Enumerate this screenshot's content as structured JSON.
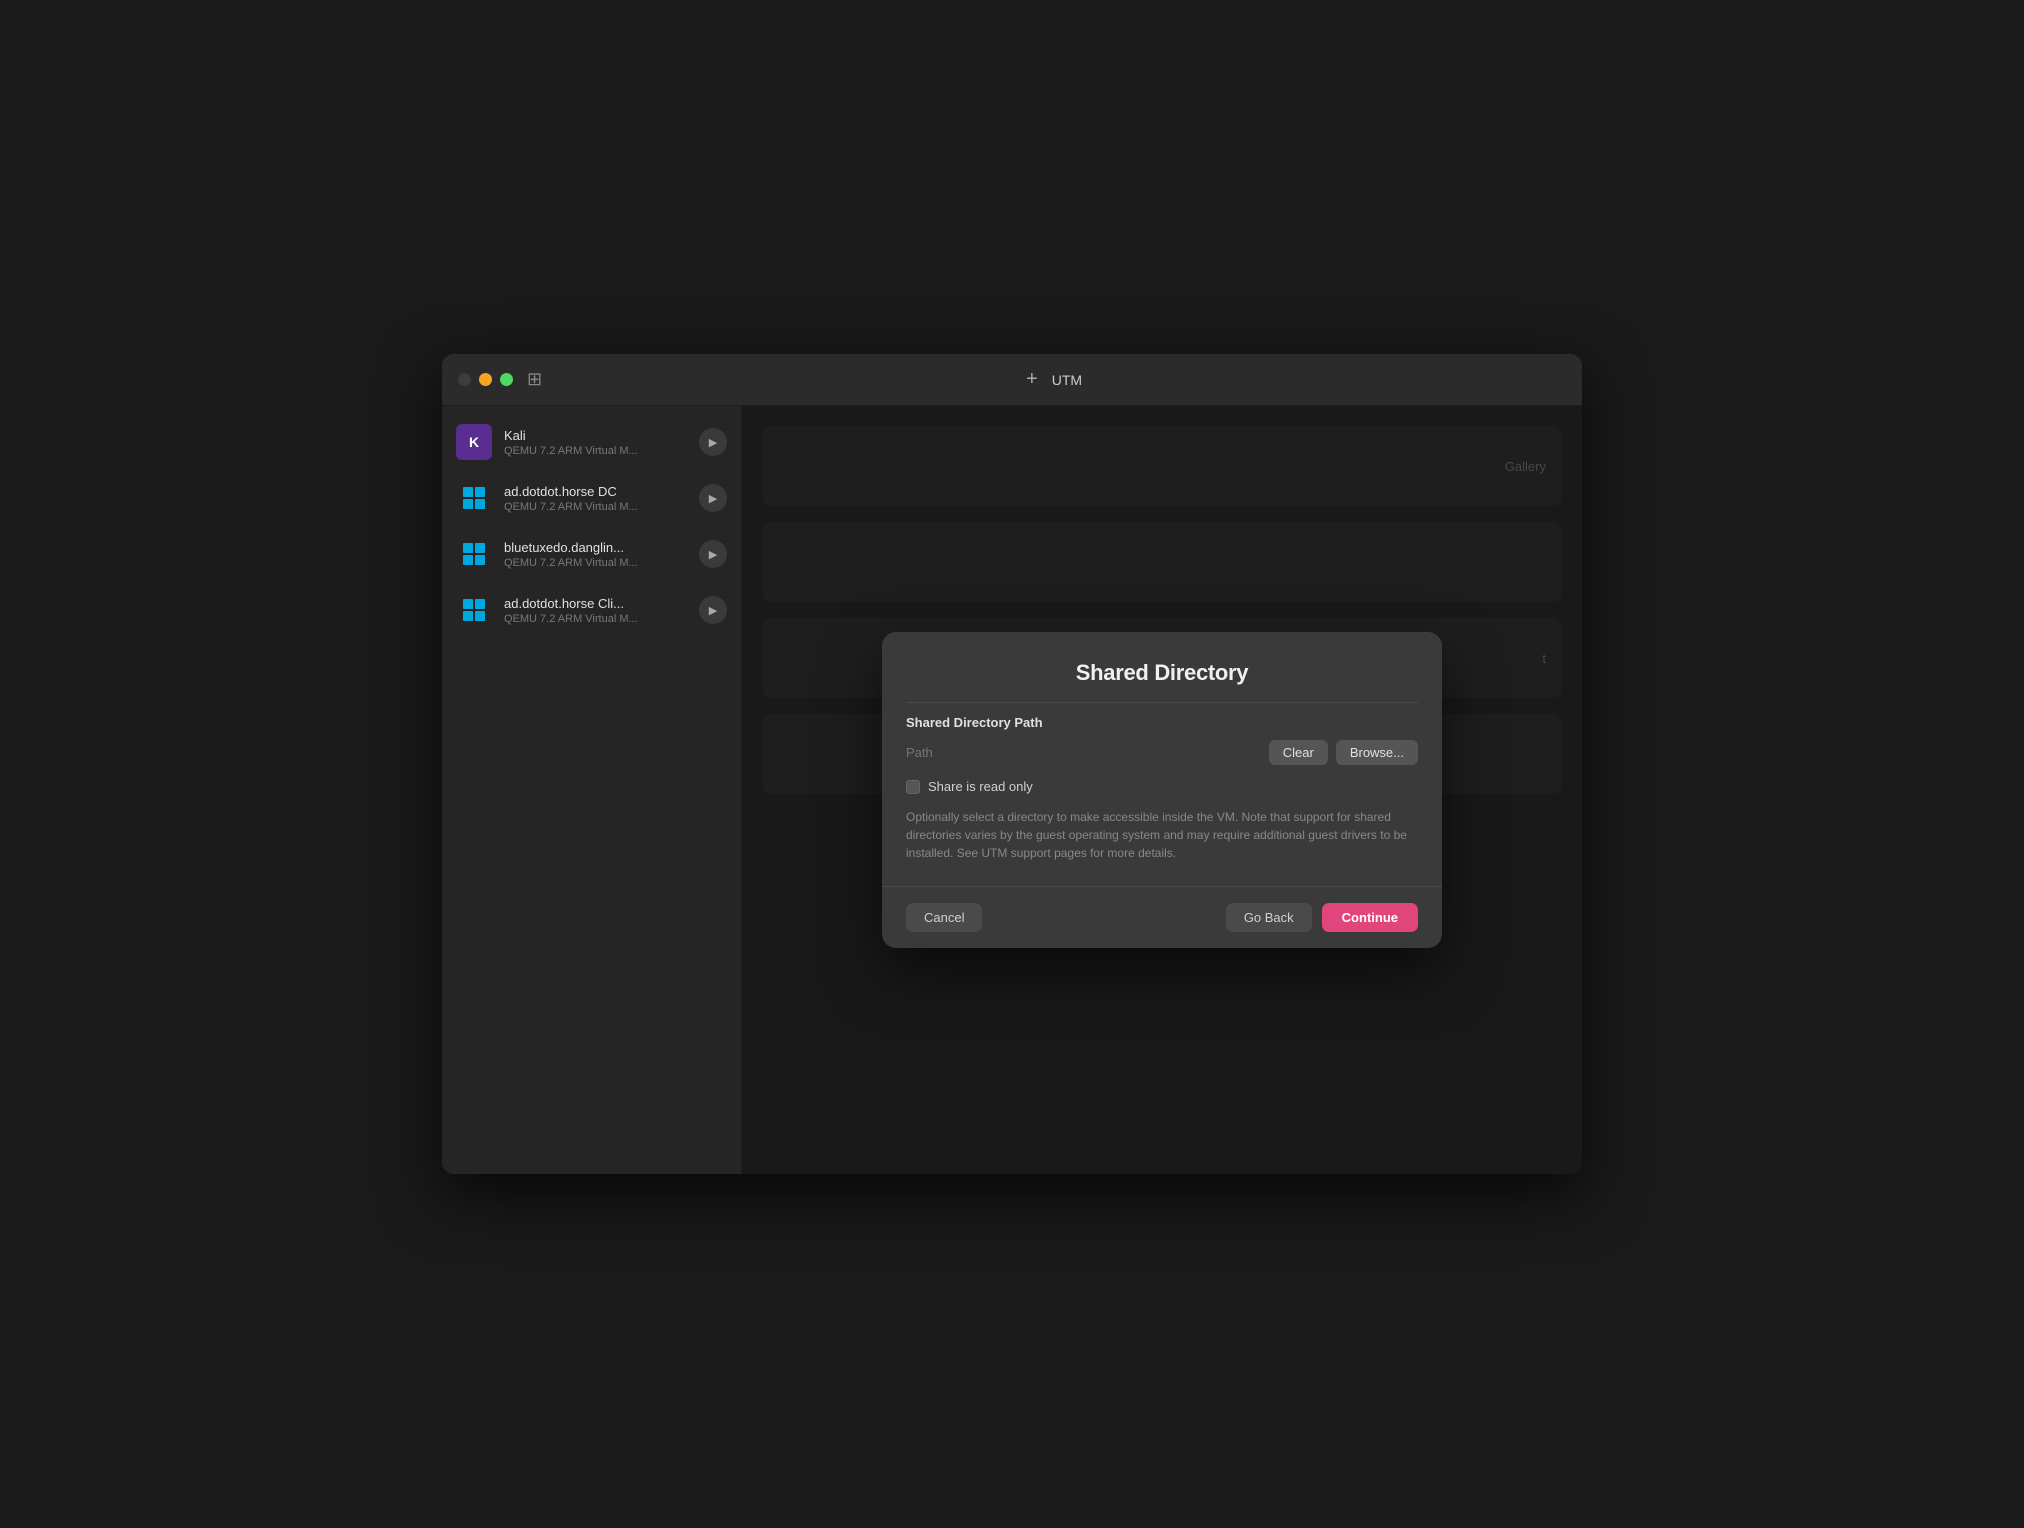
{
  "window": {
    "title": "UTM",
    "add_label": "+"
  },
  "traffic_lights": {
    "close": "close",
    "minimize": "minimize",
    "maximize": "maximize"
  },
  "sidebar": {
    "items": [
      {
        "id": "kali",
        "name": "Kali",
        "desc": "QEMU 7.2 ARM Virtual M...",
        "icon_type": "kali"
      },
      {
        "id": "addotdot-dc",
        "name": "ad.dotdot.horse DC",
        "desc": "QEMU 7.2 ARM Virtual M...",
        "icon_type": "windows"
      },
      {
        "id": "bluetuxedo",
        "name": "bluetuxedo.danglin...",
        "desc": "QEMU 7.2 ARM Virtual M...",
        "icon_type": "windows"
      },
      {
        "id": "addotdot-cli",
        "name": "ad.dotdot.horse Cli...",
        "desc": "QEMU 7.2 ARM Virtual M...",
        "icon_type": "windows"
      }
    ]
  },
  "bg_cards": [
    {
      "label": "Gallery"
    },
    {
      "label": ""
    },
    {
      "label": "t"
    },
    {
      "label": ""
    }
  ],
  "modal": {
    "title": "Shared Directory",
    "section_label": "Shared Directory Path",
    "path_placeholder": "Path",
    "clear_button": "Clear",
    "browse_button": "Browse...",
    "checkbox_label": "Share is read only",
    "description": "Optionally select a directory to make accessible inside the VM. Note that support for shared directories varies by the guest operating system and may require additional guest drivers to be installed. See UTM support pages for more details.",
    "cancel_button": "Cancel",
    "go_back_button": "Go Back",
    "continue_button": "Continue"
  }
}
